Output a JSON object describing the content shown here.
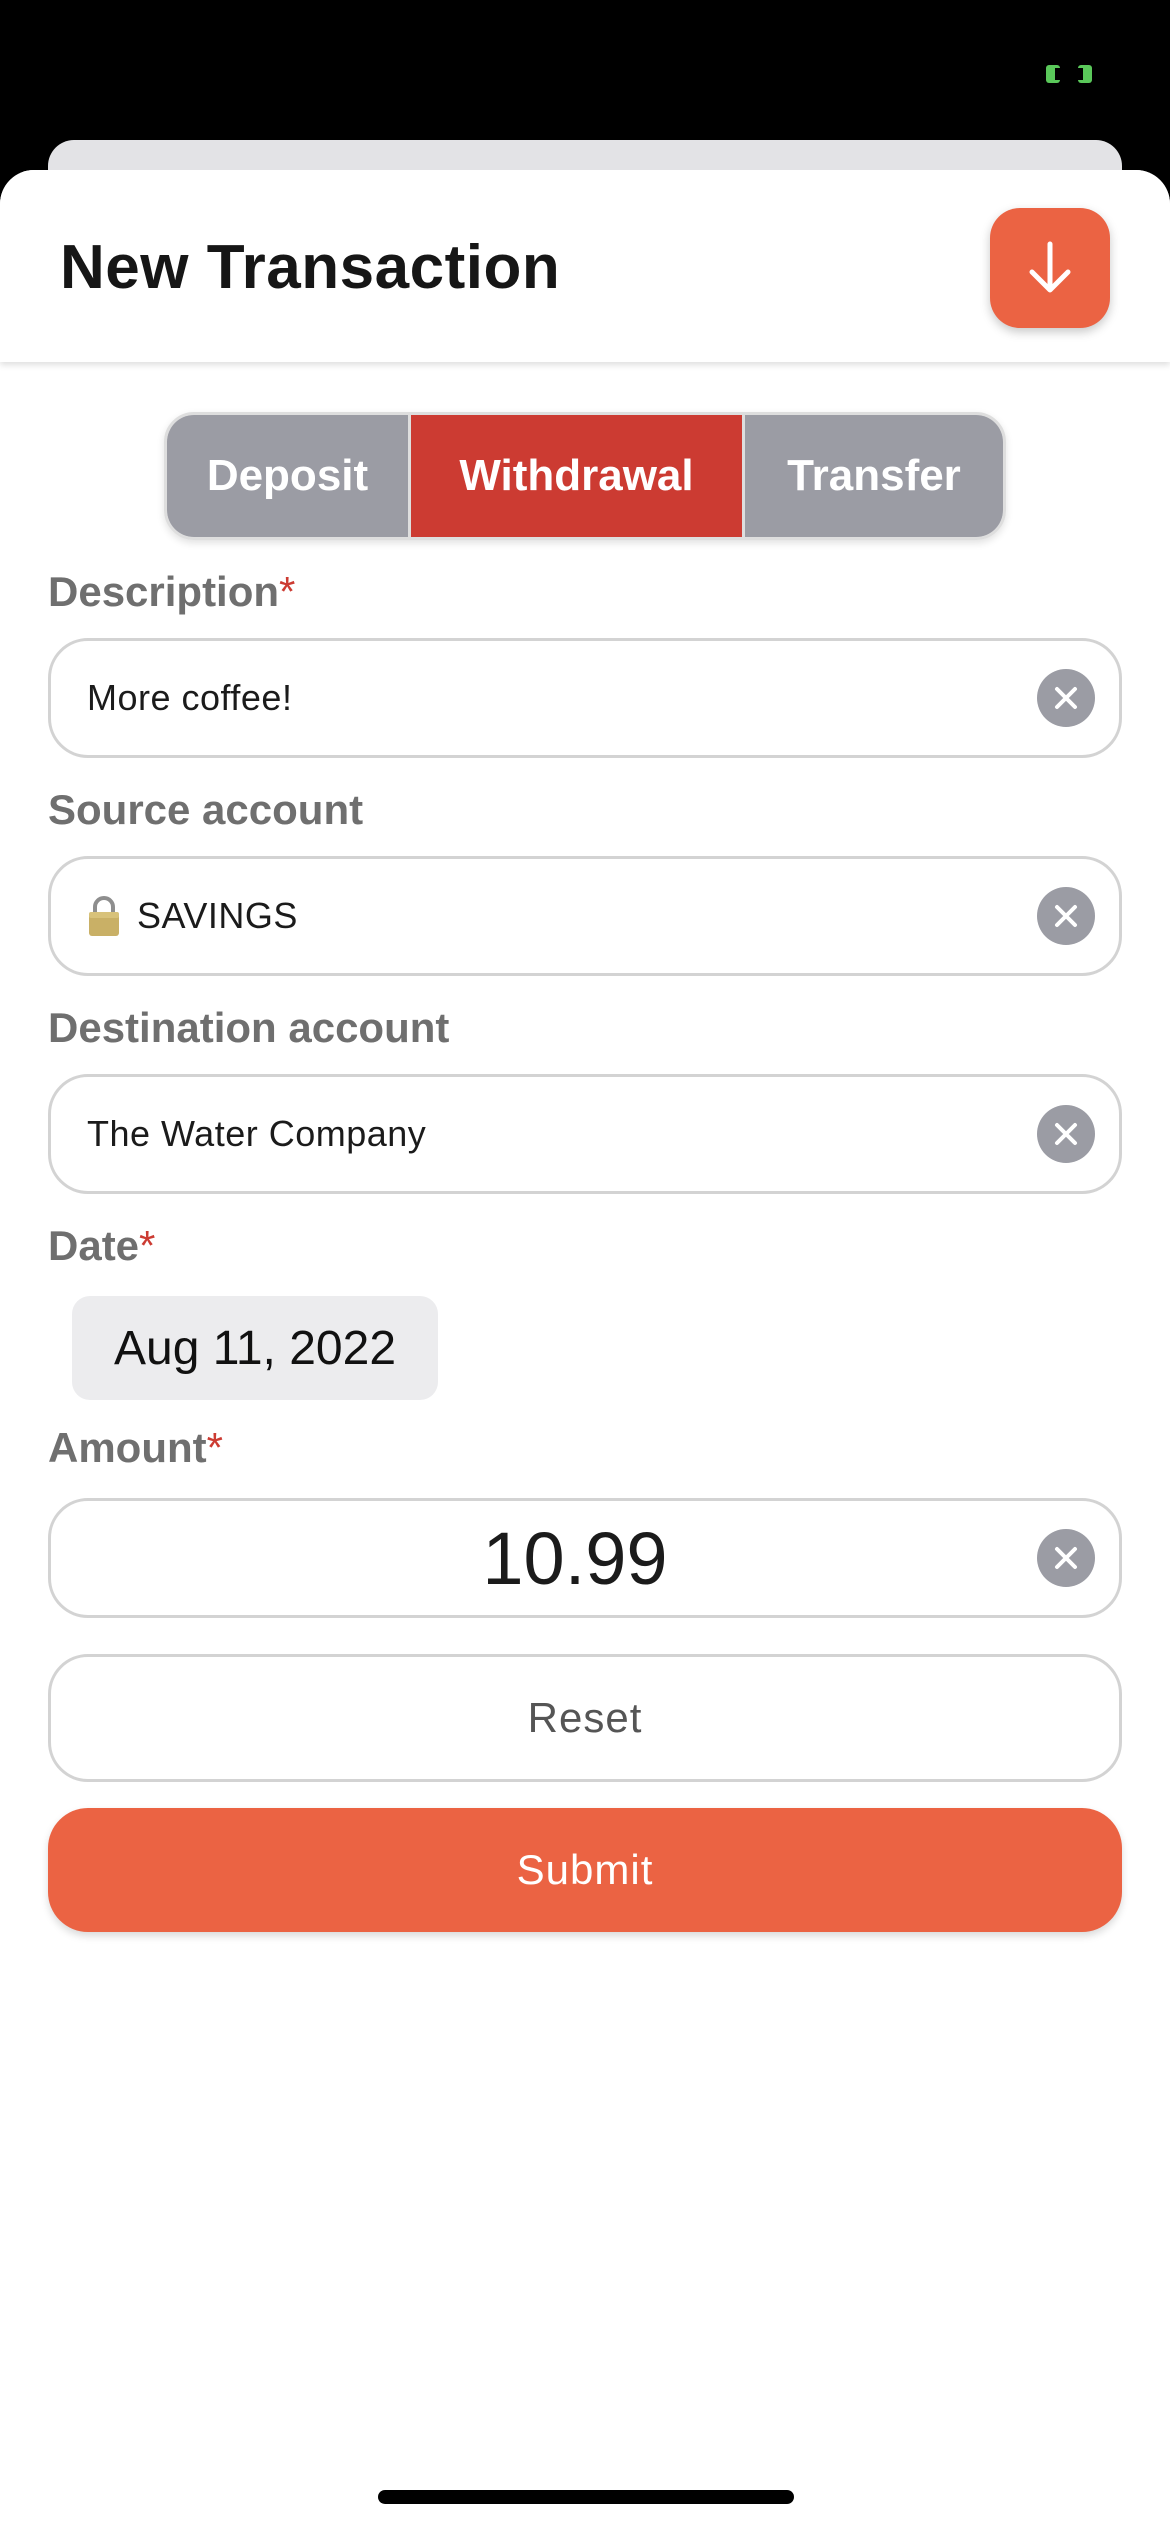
{
  "header": {
    "title": "New Transaction",
    "collapse_icon": "arrow-down-icon"
  },
  "type_selector": {
    "options": [
      "Deposit",
      "Withdrawal",
      "Transfer"
    ],
    "selected": "Withdrawal"
  },
  "form": {
    "description": {
      "label": "Description",
      "required_mark": "*",
      "value": "More coffee!"
    },
    "source_account": {
      "label": "Source account",
      "icon": "lock-icon",
      "value": "SAVINGS"
    },
    "destination_account": {
      "label": "Destination account",
      "value": "The Water Company"
    },
    "date": {
      "label": "Date",
      "required_mark": "*",
      "value": "Aug 11, 2022"
    },
    "amount": {
      "label": "Amount",
      "required_mark": "*",
      "value": "10.99"
    }
  },
  "actions": {
    "reset_label": "Reset",
    "submit_label": "Submit"
  },
  "colors": {
    "accent": "#eb6343",
    "selected_segment": "#cc3b32",
    "unselected_segment": "#9b9ca4",
    "required": "#cc3b32",
    "battery": "#5ac85a"
  }
}
